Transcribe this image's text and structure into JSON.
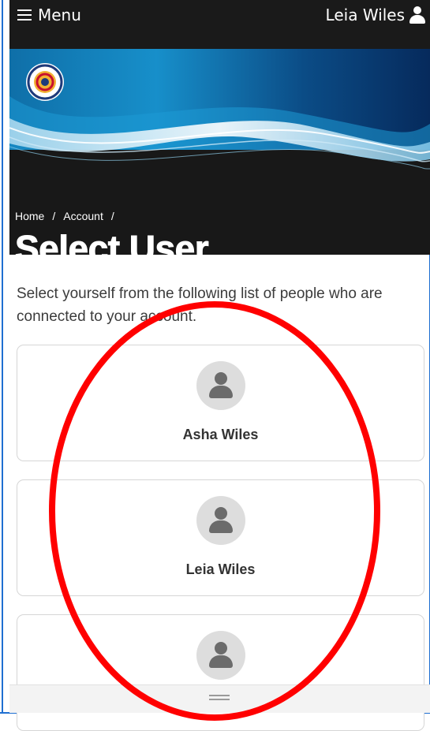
{
  "header": {
    "menu_label": "Menu",
    "user_label": "Leia Wiles"
  },
  "breadcrumb": {
    "items": [
      "Home",
      "Account"
    ],
    "separator": "/"
  },
  "page_title": "Select User",
  "intro_text": "Select yourself from the following list of people who are connected to your account.",
  "users": [
    {
      "name": "Asha Wiles"
    },
    {
      "name": "Leia Wiles"
    },
    {
      "name": ""
    }
  ],
  "colors": {
    "header_bg": "#1a1a1a",
    "hero_blue": "#1c88c4",
    "annotation_red": "#ff0000",
    "frame_blue": "#1f6fd1"
  },
  "icons": {
    "menu": "hamburger-icon",
    "user": "person-icon",
    "avatar": "person-icon",
    "seal": "city-seal-icon",
    "sheet_handle": "drag-handle-icon"
  }
}
